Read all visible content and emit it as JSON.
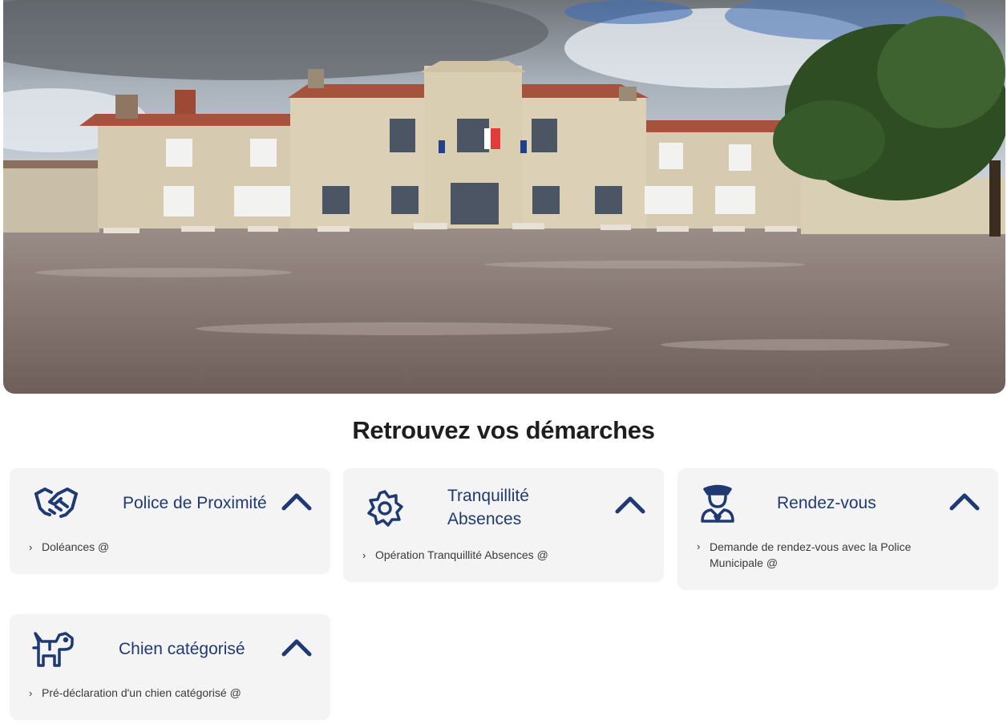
{
  "hero": {
    "icon": "town-hall-photo"
  },
  "section_title": "Retrouvez vos démarches",
  "cards": [
    {
      "title": "Police de Proximité",
      "icon": "handshake-icon",
      "links": [
        {
          "label": "Doléances @"
        }
      ]
    },
    {
      "title_line1": "Tranquillité",
      "title_line2": "Absences",
      "icon": "gear-badge-icon",
      "links": [
        {
          "label": "Opération Tranquillité Absences @"
        }
      ]
    },
    {
      "title": "Rendez-vous",
      "icon": "police-officer-icon",
      "links": [
        {
          "label_line1": "Demande de rendez-vous avec la Police",
          "label_line2": "Municipale @"
        }
      ]
    },
    {
      "title": "Chien catégorisé",
      "icon": "dog-icon",
      "links": [
        {
          "label": "Pré-déclaration d'un chien catégorisé @"
        }
      ]
    }
  ],
  "colors": {
    "accent": "#1f3a73",
    "card_bg": "#f4f4f5",
    "title": "#1e1e1e"
  }
}
